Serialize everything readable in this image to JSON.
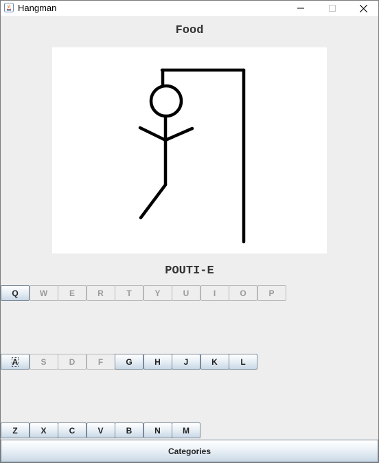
{
  "window": {
    "title": "Hangman",
    "controls": {
      "minimize": "—",
      "maximize": "☐",
      "close": "✕"
    }
  },
  "game": {
    "category": "Food",
    "word_display": "POUTI-E",
    "wrong_guesses": 5
  },
  "keyboard": {
    "row1": [
      {
        "letter": "Q",
        "enabled": true
      },
      {
        "letter": "W",
        "enabled": false
      },
      {
        "letter": "E",
        "enabled": false
      },
      {
        "letter": "R",
        "enabled": false
      },
      {
        "letter": "T",
        "enabled": false
      },
      {
        "letter": "Y",
        "enabled": false
      },
      {
        "letter": "U",
        "enabled": false
      },
      {
        "letter": "I",
        "enabled": false
      },
      {
        "letter": "O",
        "enabled": false
      },
      {
        "letter": "P",
        "enabled": false
      }
    ],
    "row2": [
      {
        "letter": "A",
        "enabled": true,
        "focused": true
      },
      {
        "letter": "S",
        "enabled": false
      },
      {
        "letter": "D",
        "enabled": false
      },
      {
        "letter": "F",
        "enabled": false
      },
      {
        "letter": "G",
        "enabled": true
      },
      {
        "letter": "H",
        "enabled": true
      },
      {
        "letter": "J",
        "enabled": true
      },
      {
        "letter": "K",
        "enabled": true
      },
      {
        "letter": "L",
        "enabled": true
      }
    ],
    "row3": [
      {
        "letter": "Z",
        "enabled": true
      },
      {
        "letter": "X",
        "enabled": true
      },
      {
        "letter": "C",
        "enabled": true
      },
      {
        "letter": "V",
        "enabled": true
      },
      {
        "letter": "B",
        "enabled": true
      },
      {
        "letter": "N",
        "enabled": true
      },
      {
        "letter": "M",
        "enabled": true
      }
    ]
  },
  "footer": {
    "categories_label": "Categories"
  },
  "colors": {
    "background": "#eeeeee",
    "canvas": "#ffffff",
    "ink": "#000000"
  }
}
